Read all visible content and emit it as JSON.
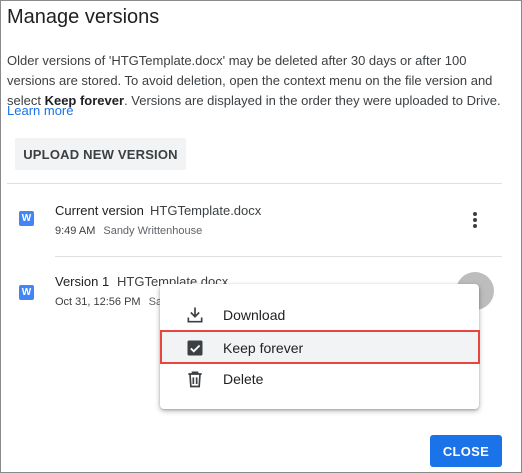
{
  "dialog": {
    "title": "Manage versions",
    "description_part1": "Older versions of 'HTGTemplate.docx' may be deleted after 30 days or after 100 versions are stored. To avoid deletion, open the context menu on the file version and select ",
    "description_bold": "Keep forever",
    "description_part2": ". Versions are displayed in the order they were uploaded to Drive.",
    "learn_more": "Learn more",
    "upload_button": "UPLOAD NEW VERSION",
    "close_button": "CLOSE"
  },
  "versions": [
    {
      "icon_letter": "W",
      "name": "Current version",
      "file": "HTGTemplate.docx",
      "time": "9:49 AM",
      "author": "Sandy Writtenhouse"
    },
    {
      "icon_letter": "W",
      "name": "Version 1",
      "file": "HTGTemplate.docx",
      "time": "Oct 31, 12:56 PM",
      "author": "Sa"
    }
  ],
  "context_menu": {
    "items": [
      {
        "label": "Download",
        "icon": "download-icon"
      },
      {
        "label": "Keep forever",
        "icon": "checkbox-checked-icon"
      },
      {
        "label": "Delete",
        "icon": "trash-icon"
      }
    ]
  },
  "colors": {
    "accent": "#1a73e8",
    "word_icon": "#4285f4",
    "highlight_border": "#e8453c"
  }
}
